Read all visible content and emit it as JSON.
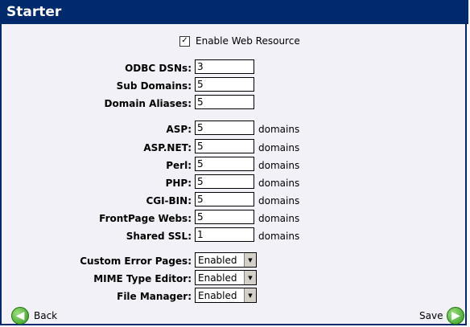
{
  "title": "Starter",
  "enable": {
    "checked_glyph": "☑",
    "label": "Enable Web Resource"
  },
  "fields": [
    {
      "label": "ODBC DSNs:",
      "value": "3"
    },
    {
      "label": "Sub Domains:",
      "value": "5"
    },
    {
      "label": "Domain Aliases:",
      "value": "5"
    }
  ],
  "domain_fields": [
    {
      "label": "ASP:",
      "value": "5",
      "unit": "domains"
    },
    {
      "label": "ASP.NET:",
      "value": "5",
      "unit": "domains"
    },
    {
      "label": "Perl:",
      "value": "5",
      "unit": "domains"
    },
    {
      "label": "PHP:",
      "value": "5",
      "unit": "domains"
    },
    {
      "label": "CGI-BIN:",
      "value": "5",
      "unit": "domains"
    },
    {
      "label": "FrontPage Webs:",
      "value": "5",
      "unit": "domains"
    },
    {
      "label": "Shared SSL:",
      "value": "1",
      "unit": "domains"
    }
  ],
  "selects": [
    {
      "label": "Custom Error Pages:",
      "value": "Enabled"
    },
    {
      "label": "MIME Type Editor:",
      "value": "Enabled"
    },
    {
      "label": "File Manager:",
      "value": "Enabled"
    }
  ],
  "nav": {
    "back_label": "Back",
    "save_label": "Save",
    "back_icon": "back-arrow-icon",
    "save_icon": "forward-arrow-icon"
  },
  "colors": {
    "header": "#002a6c",
    "panel_bg": "#f1f1f7",
    "icon_green": "#2f9a1c"
  }
}
